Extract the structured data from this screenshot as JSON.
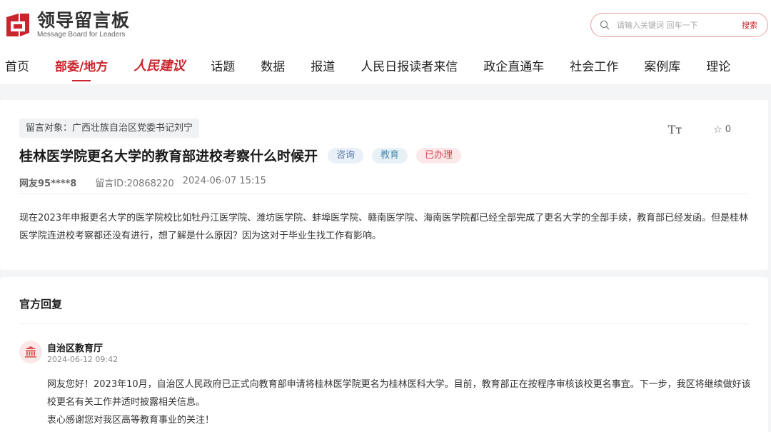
{
  "header": {
    "logo_cn": "领导留言板",
    "logo_en": "Message Board for Leaders",
    "search_placeholder": "请输入关键词 回车一下",
    "search_button": "搜索"
  },
  "nav": {
    "items": [
      "首页",
      "部委/地方",
      "人民建议",
      "话题",
      "数据",
      "报道",
      "人民日报读者来信",
      "政企直通车",
      "社会工作",
      "案例库",
      "理论"
    ],
    "active_index": 1
  },
  "message": {
    "target": "留言对象：广西壮族自治区党委书记刘宁",
    "star_count": "0",
    "font_size_label": "Tт",
    "title": "桂林医学院更名大学的教育部进校考察什么时候开",
    "tags": [
      "咨询",
      "教育",
      "已办理"
    ],
    "user": "网友95****8",
    "message_id": "留言ID:20868220",
    "time": "2024-06-07 15:15",
    "content": "现在2023年申报更名大学的医学院校比如牡丹江医学院、潍坊医学院、蚌埠医学院、赣南医学院、海南医学院都已经全部完成了更名大学的全部手续，教育部已经发函。但是桂林医学院连进校考察都还没有进行，想了解是什么原因？因为这对于毕业生找工作有影响。"
  },
  "reply": {
    "heading": "官方回复",
    "org": "自治区教育厅",
    "time": "2024-06-12 09:42",
    "paragraphs": [
      "网友您好！2023年10月，自治区人民政府已正式向教育部申请将桂林医学院更名为桂林医科大学。目前，教育部正在按程序审核该校更名事宜。下一步，我区将继续做好该校更名有关工作并适时披露相关信息。",
      "衷心感谢您对我区高等教育事业的关注！"
    ]
  },
  "colors": {
    "brand_red": "#c8252c"
  }
}
